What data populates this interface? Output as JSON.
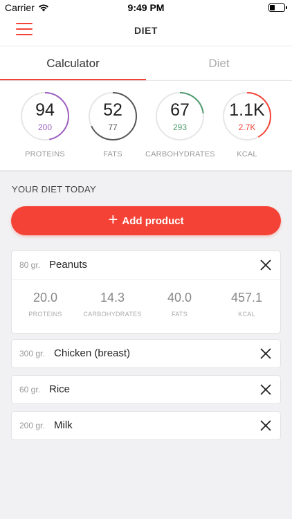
{
  "status_bar": {
    "carrier": "Carrier",
    "time": "9:49 PM"
  },
  "nav": {
    "title": "DIET",
    "menu_icon": "hamburger-icon"
  },
  "tabs": [
    {
      "label": "Calculator",
      "active": true
    },
    {
      "label": "Diet",
      "active": false
    }
  ],
  "stats": [
    {
      "value": "94",
      "goal": "200",
      "label": "PROTEINS",
      "color": "#9c5fbf",
      "progress": 0.47
    },
    {
      "value": "52",
      "goal": "77",
      "label": "FATS",
      "color": "#555555",
      "progress": 0.68
    },
    {
      "value": "67",
      "goal": "293",
      "label": "CARBOHYDRATES",
      "color": "#4e9a6b",
      "progress": 0.23
    },
    {
      "value": "1.1K",
      "goal": "2.7K",
      "label": "KCAL",
      "color": "#f44336",
      "progress": 0.42
    }
  ],
  "section_title": "YOUR DIET TODAY",
  "add_button": {
    "label": "Add product",
    "icon": "plus-icon"
  },
  "products": [
    {
      "weight": "80 gr.",
      "name": "Peanuts",
      "expanded": true,
      "nutrients": [
        {
          "value": "20.0",
          "label": "PROTEINS"
        },
        {
          "value": "14.3",
          "label": "CARBOHYDRATES"
        },
        {
          "value": "40.0",
          "label": "FATS"
        },
        {
          "value": "457.1",
          "label": "KCAL"
        }
      ]
    },
    {
      "weight": "300 gr.",
      "name": "Chicken (breast)",
      "expanded": false
    },
    {
      "weight": "60 gr.",
      "name": "Rice",
      "expanded": false
    },
    {
      "weight": "200 gr.",
      "name": "Milk",
      "expanded": false
    }
  ],
  "colors": {
    "accent": "#f44336"
  }
}
